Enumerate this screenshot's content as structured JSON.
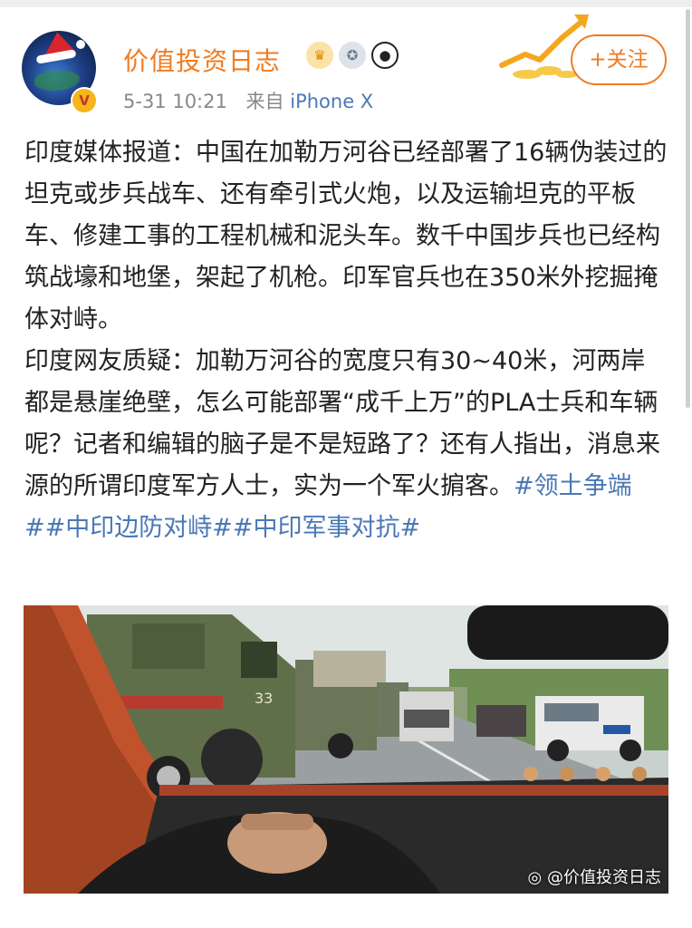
{
  "user": {
    "name": "价值投资日志",
    "badges": [
      "crown-badge-icon",
      "medal-badge-icon",
      "panda-badge-icon"
    ],
    "verified": "V"
  },
  "meta": {
    "time": "5-31 10:21",
    "from": "来自",
    "source": "iPhone X"
  },
  "follow_label": "+关注",
  "post": {
    "para1": "印度媒体报道：中国在加勒万河谷已经部署了16辆伪装过的坦克或步兵战车、还有牵引式火炮，以及运输坦克的平板车、修建工事的工程机械和泥头车。数千中国步兵也已经构筑战壕和地堡，架起了机枪。印军官兵也在350米外挖掘掩体对峙。",
    "para2": "印度网友质疑：加勒万河谷的宽度只有30~40米，河两岸都是悬崖绝壁，怎么可能部署“成千上万”的PLA士兵和车辆呢？记者和编辑的脑子是不是短路了？还有人指出，消息来源的所谓印度军方人士，实为一个军火掮客。",
    "tags": [
      "#领土争端#",
      "#中印边防对峙#",
      "#中印军事对抗#"
    ]
  },
  "image": {
    "watermark": "@价值投资日志",
    "truck_number": "33"
  },
  "colors": {
    "accent_orange": "#f07b21",
    "link_blue": "#4a78b5",
    "meta_gray": "#888888"
  }
}
